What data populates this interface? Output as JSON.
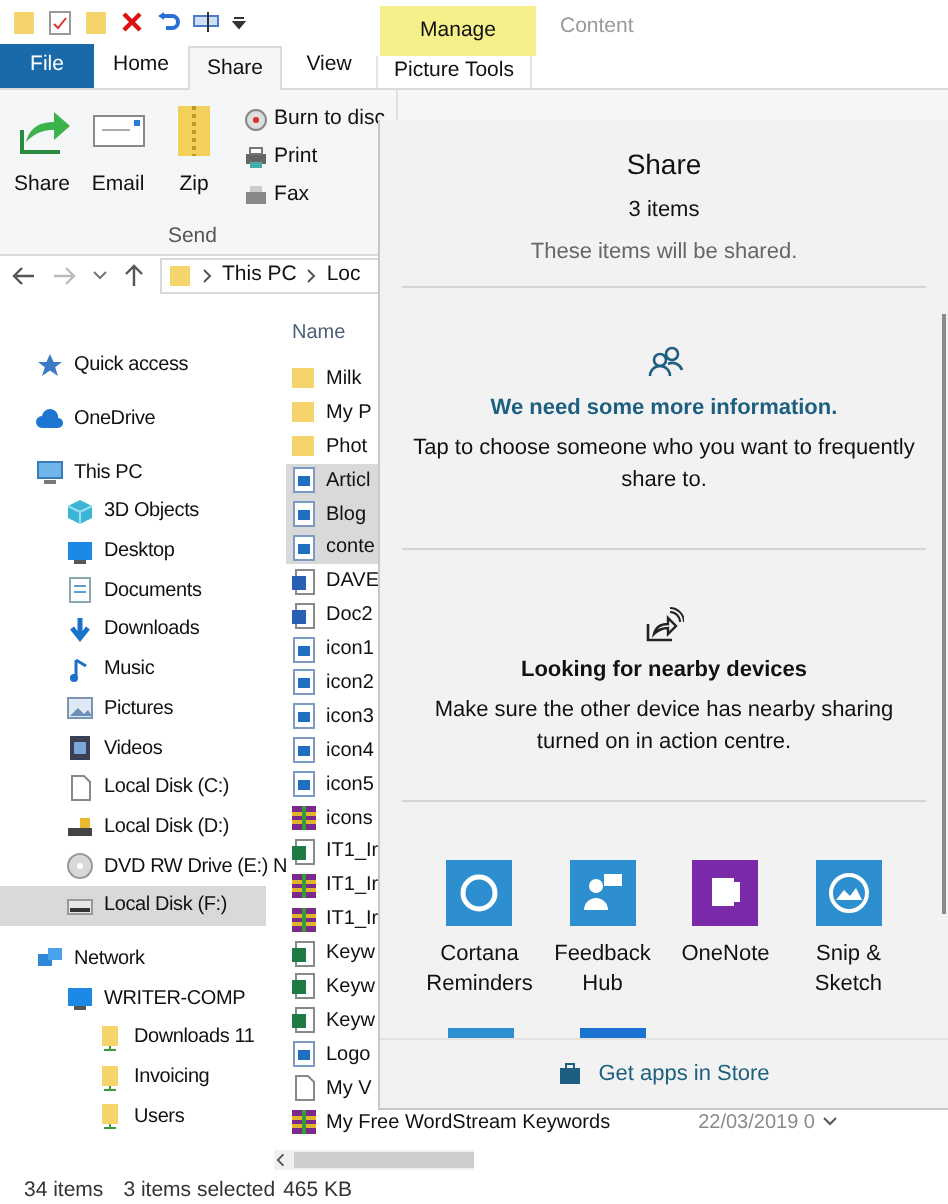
{
  "ribbon": {
    "context_group": "Manage",
    "context_label": "Content",
    "tabs": [
      {
        "label": "File",
        "kind": "file",
        "selected": false
      },
      {
        "label": "Home",
        "kind": "tab",
        "selected": false
      },
      {
        "label": "Share",
        "kind": "tab",
        "selected": true
      },
      {
        "label": "View",
        "kind": "tab",
        "selected": false
      },
      {
        "label": "Picture Tools",
        "kind": "contextual",
        "selected": false
      }
    ],
    "group": {
      "label": "Send",
      "large_buttons": [
        "Share",
        "Email",
        "Zip"
      ],
      "small_buttons": [
        "Burn to disc",
        "Print",
        "Fax"
      ]
    }
  },
  "address_bar": {
    "path": [
      "This PC",
      "Loc"
    ]
  },
  "navigation": [
    {
      "label": "Quick access",
      "kind": "star",
      "selected": false
    },
    {
      "label": "OneDrive",
      "kind": "cloud",
      "selected": false
    },
    {
      "label": "This PC",
      "kind": "pc",
      "selected": false,
      "children": [
        {
          "label": "3D Objects",
          "kind": "cube",
          "selected": false
        },
        {
          "label": "Desktop",
          "kind": "desktop",
          "selected": false
        },
        {
          "label": "Documents",
          "kind": "document",
          "selected": false
        },
        {
          "label": "Downloads",
          "kind": "download",
          "selected": false
        },
        {
          "label": "Music",
          "kind": "music",
          "selected": false
        },
        {
          "label": "Pictures",
          "kind": "pictures",
          "selected": false
        },
        {
          "label": "Videos",
          "kind": "videos",
          "selected": false
        },
        {
          "label": "Local Disk (C:)",
          "kind": "page",
          "selected": false
        },
        {
          "label": "Local Disk (D:)",
          "kind": "locked-drive",
          "selected": false
        },
        {
          "label": "DVD RW Drive (E:) N",
          "kind": "disc",
          "selected": false
        },
        {
          "label": "Local Disk (F:)",
          "kind": "drive",
          "selected": true
        }
      ]
    },
    {
      "label": "Network",
      "kind": "network",
      "selected": false,
      "children": [
        {
          "label": "WRITER-COMP",
          "kind": "desktop",
          "selected": false,
          "children": [
            {
              "label": "Downloads 11",
              "kind": "shared-folder",
              "selected": false
            },
            {
              "label": "Invoicing",
              "kind": "shared-folder",
              "selected": false
            },
            {
              "label": "Users",
              "kind": "shared-folder",
              "selected": false
            }
          ]
        }
      ]
    }
  ],
  "file_list": {
    "column_header": "Name",
    "rows": [
      {
        "name": "Milk",
        "kind": "folder",
        "selected": false
      },
      {
        "name": "My P",
        "kind": "folder",
        "selected": false
      },
      {
        "name": "Phot",
        "kind": "folder",
        "selected": false
      },
      {
        "name": "Articl",
        "kind": "image",
        "selected": true
      },
      {
        "name": "Blog",
        "kind": "image",
        "selected": true
      },
      {
        "name": "conte",
        "kind": "image",
        "selected": true
      },
      {
        "name": "DAVE",
        "kind": "word",
        "selected": false
      },
      {
        "name": "Doc2",
        "kind": "word",
        "selected": false
      },
      {
        "name": "icon1",
        "kind": "image",
        "selected": false
      },
      {
        "name": "icon2",
        "kind": "image",
        "selected": false
      },
      {
        "name": "icon3",
        "kind": "image",
        "selected": false
      },
      {
        "name": "icon4",
        "kind": "image",
        "selected": false
      },
      {
        "name": "icon5",
        "kind": "image",
        "selected": false
      },
      {
        "name": "icons",
        "kind": "archive",
        "selected": false
      },
      {
        "name": "IT1_Ir",
        "kind": "excel",
        "selected": false
      },
      {
        "name": "IT1_Ir",
        "kind": "archive",
        "selected": false
      },
      {
        "name": "IT1_Ir",
        "kind": "archive",
        "selected": false
      },
      {
        "name": "Keyw",
        "kind": "excel",
        "selected": false
      },
      {
        "name": "Keyw",
        "kind": "excel",
        "selected": false
      },
      {
        "name": "Keyw",
        "kind": "excel",
        "selected": false
      },
      {
        "name": "Logo",
        "kind": "image",
        "selected": false
      },
      {
        "name": "My V",
        "kind": "blank",
        "selected": false
      },
      {
        "name": "My Free WordStream Keywords",
        "kind": "archive",
        "selected": false,
        "date": "22/03/2019 0"
      }
    ]
  },
  "share_panel": {
    "title": "Share",
    "count": "3 items",
    "subtitle": "These items will be shared.",
    "sections": [
      {
        "kind": "people",
        "heading": "We need some more information.",
        "text": "Tap to choose someone who you want to frequently share to."
      },
      {
        "kind": "nearby",
        "heading": "Looking for nearby devices",
        "text": "Make sure the other device has nearby sharing turned on in action centre."
      }
    ],
    "apps": [
      {
        "label": "Cortana Reminders",
        "kind": "cortana",
        "color": "#2d8fd0"
      },
      {
        "label": "Feedback Hub",
        "kind": "feedback",
        "color": "#2d8fd0"
      },
      {
        "label": "OneNote",
        "kind": "onenote",
        "color": "#7a2aa8"
      },
      {
        "label": "Snip & Sketch",
        "kind": "snip",
        "color": "#2d8fd0"
      }
    ],
    "store_link": "Get apps in Store"
  },
  "status_bar": [
    "34 items",
    "3 items selected",
    "465 KB"
  ]
}
